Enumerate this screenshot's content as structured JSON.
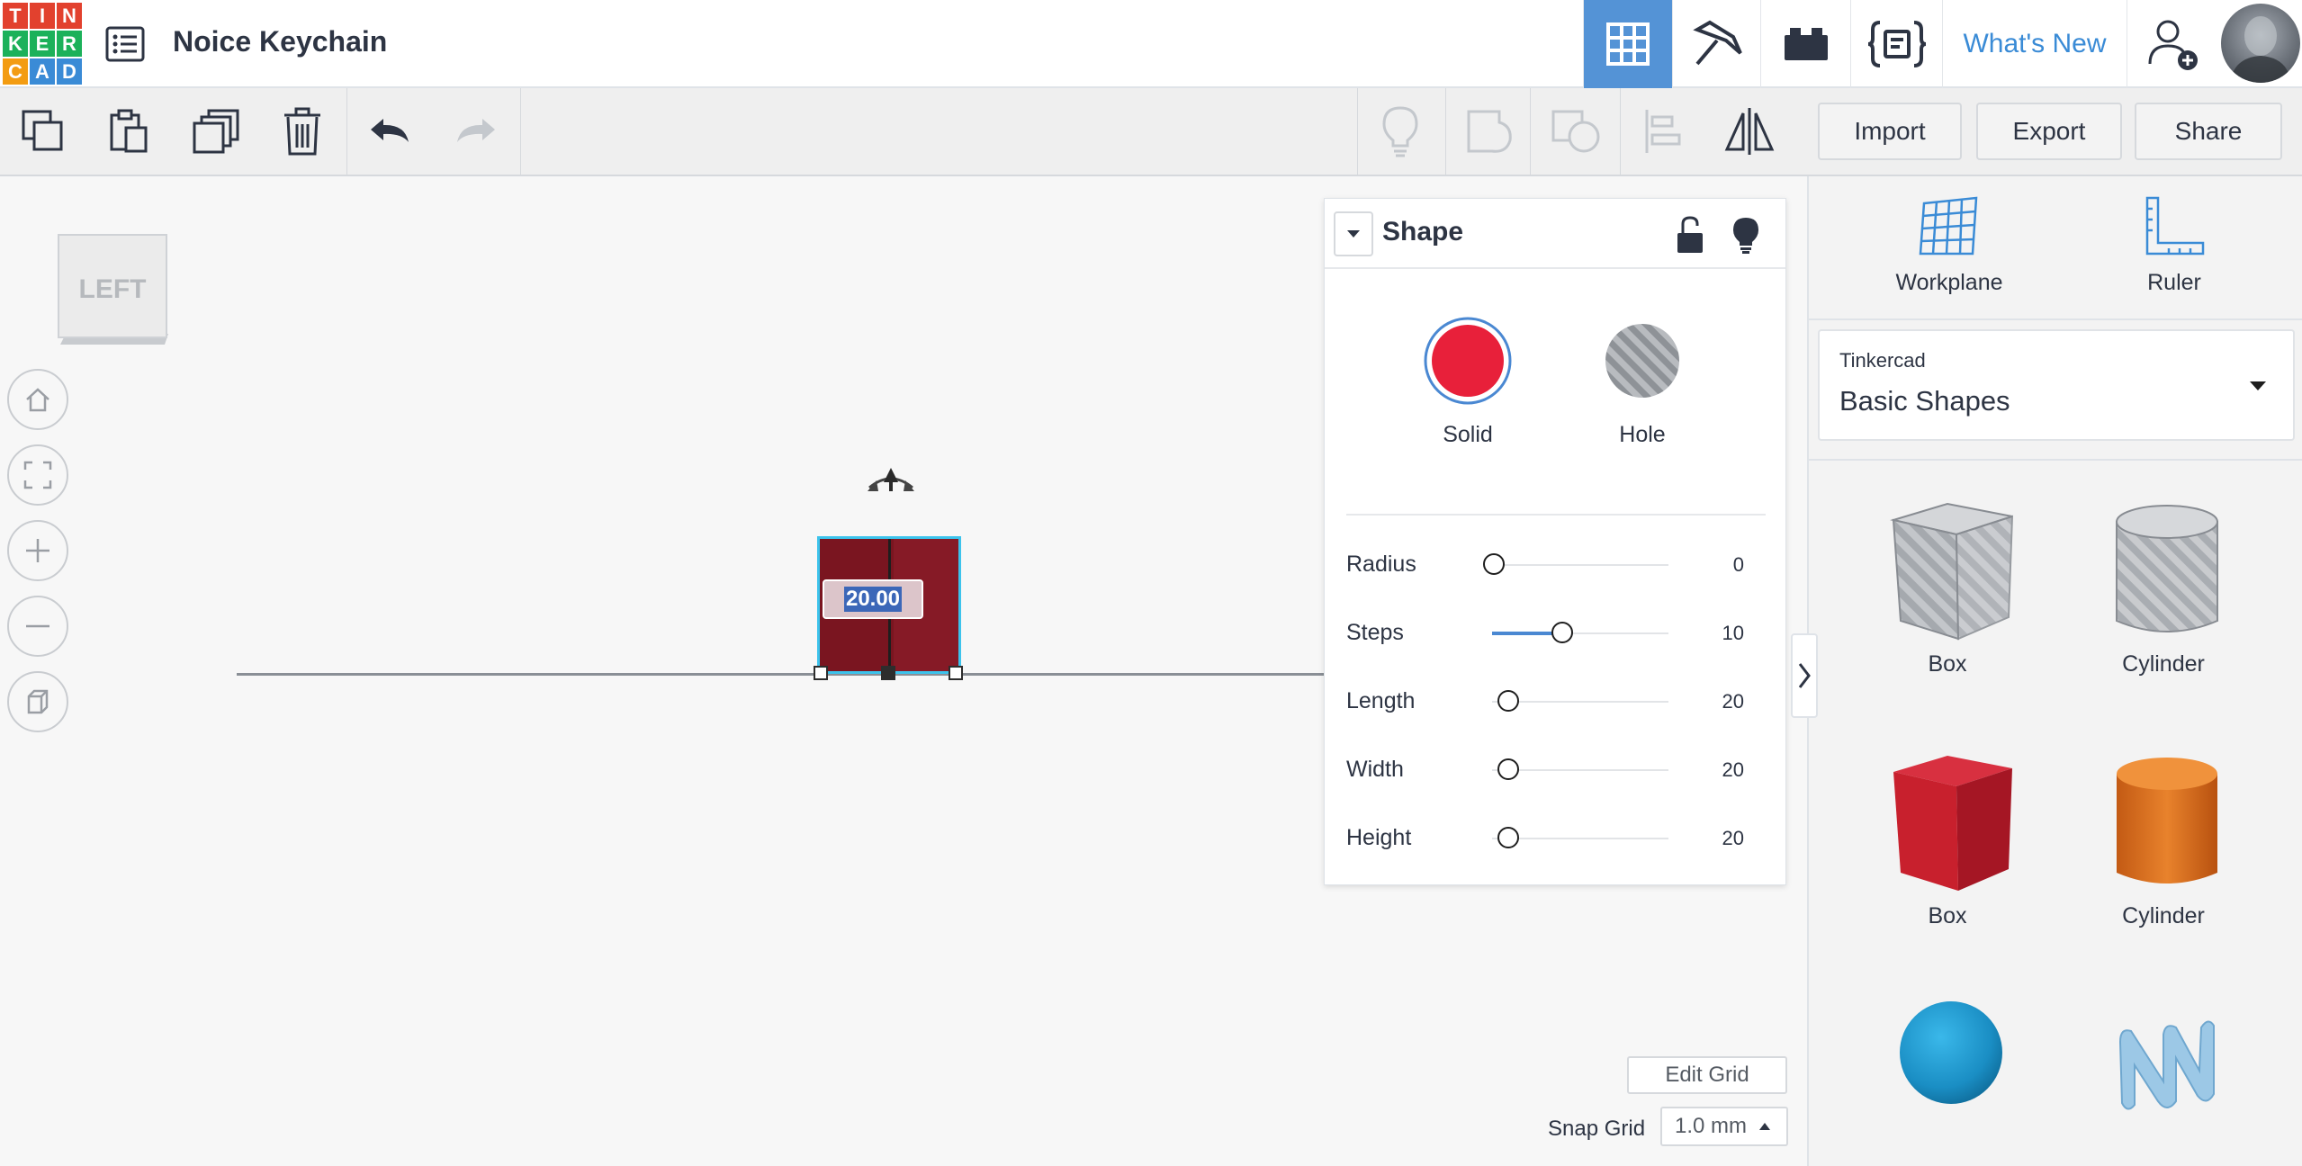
{
  "app": {
    "logo_letters": [
      "T",
      "I",
      "N",
      "K",
      "E",
      "R",
      "C",
      "A",
      "D"
    ],
    "logo_colors": [
      "#e2412e",
      "#e2412e",
      "#e2412e",
      "#1cb15a",
      "#1cb15a",
      "#1cb15a",
      "#f39c12",
      "#3a8bd6",
      "#3a8bd6"
    ],
    "project_title": "Noice Keychain"
  },
  "topbar": {
    "tabs": [
      {
        "icon": "grid-3d-icon",
        "active": true
      },
      {
        "icon": "pickaxe-icon",
        "active": false
      },
      {
        "icon": "bricks-icon",
        "active": false
      },
      {
        "icon": "codeblocks-icon",
        "active": false
      }
    ],
    "whats_new": "What's New",
    "accent_color": "#5493d6"
  },
  "toolbar": {
    "import_label": "Import",
    "export_label": "Export",
    "share_label": "Share"
  },
  "canvas": {
    "view_cube_label": "LEFT",
    "dimension_value": "20.00",
    "shape_color": "#7a1520",
    "selection_color": "#3cc3ec",
    "edit_grid_label": "Edit Grid",
    "snap_grid_label": "Snap Grid",
    "snap_grid_value": "1.0 mm"
  },
  "inspector": {
    "title": "Shape",
    "solid_label": "Solid",
    "hole_label": "Hole",
    "solid_color": "#e8203a",
    "properties": [
      {
        "label": "Radius",
        "value": "0"
      },
      {
        "label": "Steps",
        "value": "10"
      },
      {
        "label": "Length",
        "value": "20"
      },
      {
        "label": "Width",
        "value": "20"
      },
      {
        "label": "Height",
        "value": "20"
      }
    ]
  },
  "sidebar": {
    "workplane_label": "Workplane",
    "ruler_label": "Ruler",
    "library_source": "Tinkercad",
    "library_name": "Basic Shapes",
    "shapes": [
      {
        "label": "Box",
        "kind": "hole-box"
      },
      {
        "label": "Cylinder",
        "kind": "hole-cylinder"
      },
      {
        "label": "Box",
        "kind": "solid-box"
      },
      {
        "label": "Cylinder",
        "kind": "solid-cylinder"
      },
      {
        "label": "",
        "kind": "sphere"
      },
      {
        "label": "",
        "kind": "scribble"
      }
    ]
  }
}
